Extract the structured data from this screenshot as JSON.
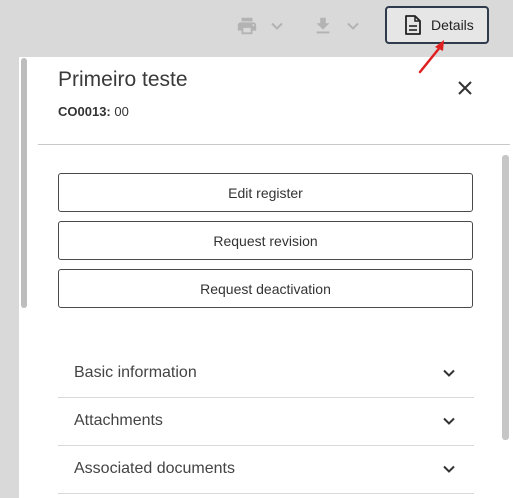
{
  "toolbar": {
    "print_icon": "printer-icon",
    "download_icon": "download-icon",
    "details_button": {
      "label": "Details",
      "icon": "document-icon"
    }
  },
  "panel": {
    "title": "Primeiro teste",
    "code_label": "CO0013:",
    "code_value": "00",
    "close_icon": "close-icon"
  },
  "actions": {
    "edit": "Edit register",
    "revision": "Request revision",
    "deactivation": "Request deactivation"
  },
  "sections": {
    "basic": "Basic information",
    "attachments": "Attachments",
    "associated": "Associated documents"
  },
  "colors": {
    "toolbar_bg": "#d9d9d9",
    "annotation_arrow": "#e02020",
    "button_border": "#2f3b4c"
  }
}
